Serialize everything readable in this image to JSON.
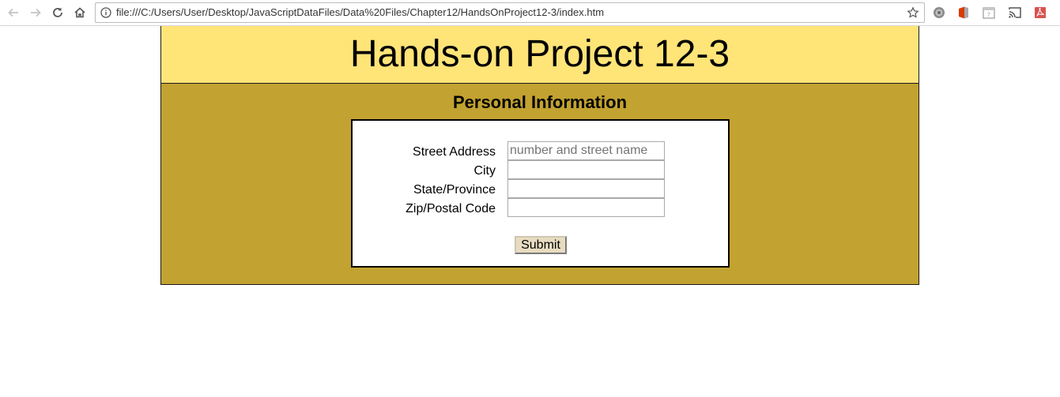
{
  "browser": {
    "url": "file:///C:/Users/User/Desktop/JavaScriptDataFiles/Data%20Files/Chapter12/HandsOnProject12-3/index.htm",
    "icons": {
      "back": "back-arrow-icon",
      "forward": "forward-arrow-icon",
      "reload": "reload-icon",
      "home": "home-icon",
      "info": "info-icon",
      "bookmark": "star-icon",
      "extensions": [
        "gear-extension-icon",
        "office-extension-icon",
        "calendar-extension-icon",
        "cast-icon",
        "pdf-extension-icon"
      ]
    }
  },
  "page": {
    "title": "Hands-on Project 12-3",
    "section_title": "Personal Information",
    "colors": {
      "header_bg": "#ffe478",
      "content_bg": "#c2a230",
      "form_bg": "#ffffff"
    }
  },
  "form": {
    "fields": [
      {
        "label": "Street Address",
        "value": "",
        "placeholder": "number and street name"
      },
      {
        "label": "City",
        "value": "",
        "placeholder": ""
      },
      {
        "label": "State/Province",
        "value": "",
        "placeholder": ""
      },
      {
        "label": "Zip/Postal Code",
        "value": "",
        "placeholder": ""
      }
    ],
    "submit_label": "Submit"
  }
}
